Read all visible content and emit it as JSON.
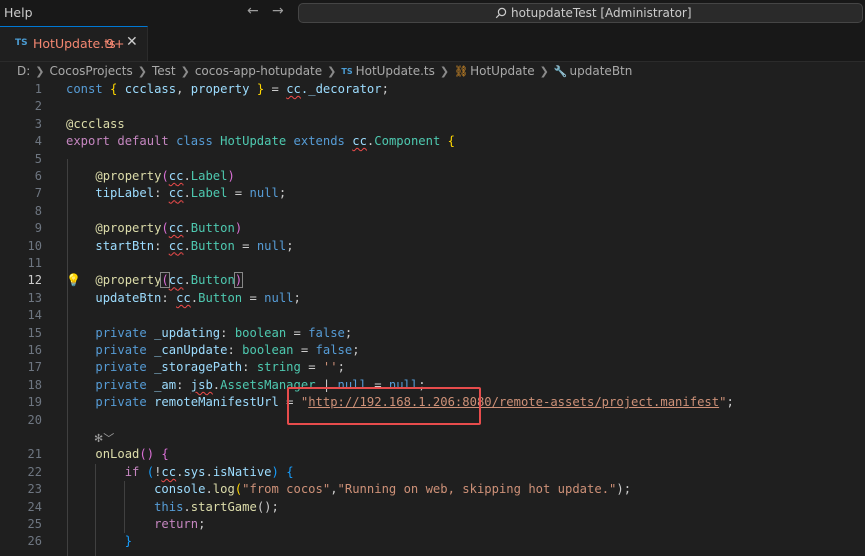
{
  "titlebar": {
    "menu_help": "Help",
    "back_icon": "arrow-left-icon",
    "forward_icon": "arrow-right-icon",
    "search_text": "hotupdateTest [Administrator]"
  },
  "tab": {
    "lang_badge": "TS",
    "title": "HotUpdate.ts",
    "problems": "9+",
    "close": "✕"
  },
  "breadcrumb": {
    "items": [
      "D:",
      "CocosProjects",
      "Test",
      "cocos-app-hotupdate",
      "HotUpdate.ts",
      "HotUpdate",
      "updateBtn"
    ]
  },
  "editor": {
    "active_line": "12",
    "line_numbers": [
      "1",
      "2",
      "3",
      "4",
      "5",
      "6",
      "7",
      "8",
      "9",
      "10",
      "11",
      "12",
      "13",
      "14",
      "15",
      "16",
      "17",
      "18",
      "19",
      "20",
      "21",
      "22",
      "23",
      "24",
      "25",
      "26"
    ],
    "lines": {
      "l1": [
        "const",
        "{",
        "ccclass",
        ",",
        "property",
        "}",
        "=",
        "cc",
        "._decorator",
        ";"
      ],
      "l3": [
        "@",
        "ccclass"
      ],
      "l4": [
        "export",
        "default",
        "class",
        "HotUpdate",
        "extends",
        "cc",
        ".",
        "Component",
        "{"
      ],
      "l6": [
        "@",
        "property",
        "(",
        "cc",
        ".",
        "Label",
        ")"
      ],
      "l7": [
        "tipLabel",
        ": ",
        "cc",
        ".",
        "Label",
        " = ",
        "null",
        ";"
      ],
      "l9": [
        "@",
        "property",
        "(",
        "cc",
        ".",
        "Button",
        ")"
      ],
      "l10": [
        "startBtn",
        ": ",
        "cc",
        ".",
        "Button",
        " = ",
        "null",
        ";"
      ],
      "l12": [
        "@",
        "property",
        "(",
        "cc",
        ".",
        "Button",
        ")"
      ],
      "l13": [
        "updateBtn",
        ": ",
        "cc",
        ".",
        "Button",
        " = ",
        "null",
        ";"
      ],
      "l15": [
        "private",
        "_updating",
        ": ",
        "boolean",
        " = ",
        "false",
        ";"
      ],
      "l16": [
        "private",
        "_canUpdate",
        ": ",
        "boolean",
        " = ",
        "false",
        ";"
      ],
      "l17": [
        "private",
        "_storagePath",
        ": ",
        "string",
        " = ",
        "''",
        ";"
      ],
      "l18": [
        "private",
        "_am",
        ": ",
        "jsb",
        ".",
        "AssetsManager",
        " | ",
        "null",
        " = ",
        "null",
        ";"
      ],
      "l19": [
        "private",
        "remoteManifestUrl",
        " = ",
        "\"",
        "http://192.168.1.206:8080/remote-assets/project.manifest",
        "\"",
        ";"
      ],
      "l21": [
        "onLoad",
        "()",
        "{"
      ],
      "l22": [
        "if",
        "(",
        "!",
        "cc",
        ".",
        "sys",
        ".",
        "isNative",
        ")",
        "{"
      ],
      "l23": [
        "console",
        ".",
        "log",
        "(",
        "\"from cocos\"",
        ",",
        "\"Running on web, skipping hot update.\"",
        ");"
      ],
      "l24": [
        "this",
        ".",
        "startGame",
        "();"
      ],
      "l25": [
        "return",
        ";"
      ],
      "l26": [
        "}"
      ]
    }
  },
  "icons": {
    "search": "search-icon",
    "lightbulb": "lightbulb-icon",
    "codelens": "codelens-icon",
    "class": "class-icon",
    "method": "wrench-icon"
  },
  "colors": {
    "accent": "#0078d4",
    "error_tab": "#f48771",
    "highlight_box": "#e74c4c"
  }
}
